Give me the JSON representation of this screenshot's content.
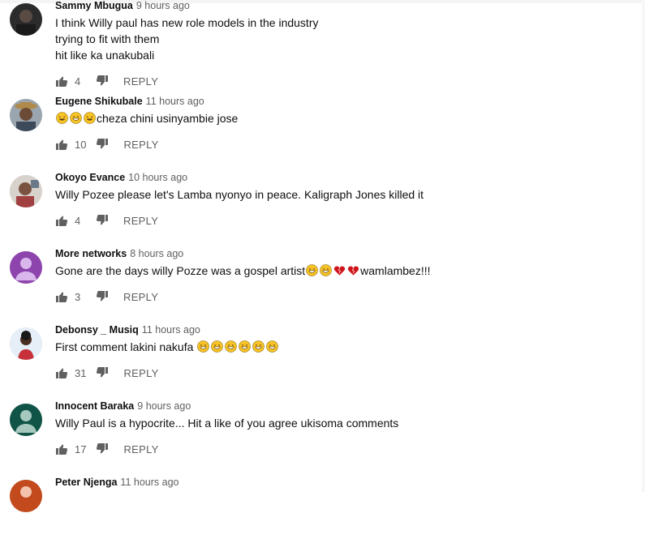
{
  "comments": [
    {
      "author": "Sammy Mbugua",
      "time": "9 hours ago",
      "lines": [
        "I think Willy paul has new role models in the industry",
        "trying to fit with them",
        "hit like ka unakubali"
      ],
      "likes": "4",
      "reply": "REPLY"
    },
    {
      "author": "Eugene Shikubale",
      "time": "11 hours ago",
      "text": "cheza chini usinyambie jose",
      "likes": "10",
      "reply": "REPLY"
    },
    {
      "author": "Okoyo Evance",
      "time": "10 hours ago",
      "text": "Willy Pozee please let's Lamba nyonyo in peace. Kaligraph Jones killed it",
      "likes": "4",
      "reply": "REPLY"
    },
    {
      "author": "More networks",
      "time": "8 hours ago",
      "text": "Gone are the days willy Pozze was a gospel artist",
      "text_suffix": "wamlambez!!!",
      "likes": "3",
      "reply": "REPLY"
    },
    {
      "author": "Debonsy _ Musiq",
      "time": "11 hours ago",
      "text": "First comment lakini nakufa ",
      "likes": "31",
      "reply": "REPLY"
    },
    {
      "author": "Innocent Baraka",
      "time": "9 hours ago",
      "text": "Willy Paul is a hypocrite... Hit a like of you agree ukisoma comments",
      "likes": "17",
      "reply": "REPLY"
    },
    {
      "author": "Peter Njenga",
      "time": "11 hours ago"
    }
  ],
  "icons": {
    "like": "thumbs-up-icon",
    "dislike": "thumbs-down-icon",
    "laugh": "rofl-emoji",
    "grin": "grinning-sweat-emoji",
    "heart": "broken-heart-emoji"
  },
  "colors": {
    "author": "#0f0f0f",
    "meta": "#606060",
    "purple_avatar": "#8e44ad",
    "green_avatar": "#0f5446",
    "orange_avatar": "#c24a1c"
  }
}
